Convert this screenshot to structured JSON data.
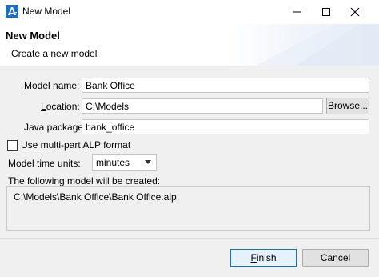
{
  "window": {
    "title": "New Model",
    "icon": "anylogic-logo-icon"
  },
  "banner": {
    "title": "New Model",
    "description": "Create a new model"
  },
  "form": {
    "model_name_label": "Model name:",
    "model_name_value": "Bank Office",
    "location_label": "Location:",
    "location_value": "C:\\Models",
    "browse_label": "Browse...",
    "java_package_label": "Java package:",
    "java_package_value": "bank_office",
    "multipart_label": "Use multi-part ALP format",
    "multipart_checked": false,
    "time_units_label": "Model time units:",
    "time_units_value": "minutes",
    "result_label": "The following model will be created:",
    "result_path": "C:\\Models\\Bank Office\\Bank Office.alp"
  },
  "buttons": {
    "finish_label": "Finish",
    "cancel_label": "Cancel"
  },
  "colors": {
    "accent": "#0078d7",
    "content_bg": "#f0f0f0"
  }
}
